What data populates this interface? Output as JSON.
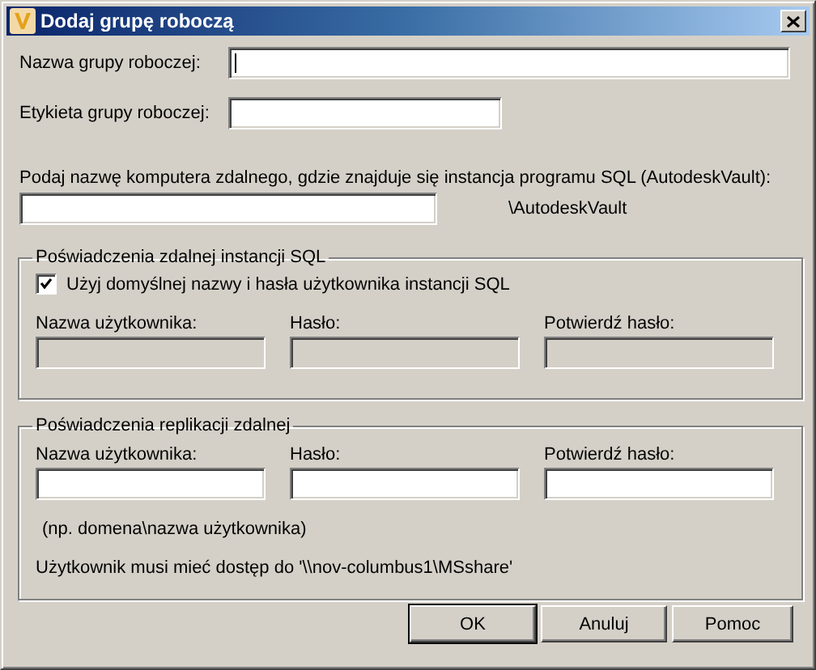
{
  "window": {
    "title": "Dodaj grupę roboczą"
  },
  "fields": [
    {
      "label": "Nazwa grupy roboczej:",
      "focused": true
    },
    {
      "label": "Etykieta grupy roboczej:",
      "focused": false
    }
  ],
  "server": {
    "label": "Podaj nazwę komputera zdalnego, gdzie znajduje się instancja programu SQL (AutodeskVault):",
    "suffix": "\\AutodeskVault"
  },
  "groups": [
    {
      "title": "Poświadczenia zdalnej instancji SQL",
      "checkbox": {
        "label": "Użyj domyślnej nazwy i hasła użytkownika instancji SQL",
        "checked": true
      },
      "fields": [
        {
          "label": "Nazwa użytkownika:",
          "disabled": true
        },
        {
          "label": "Hasło:",
          "disabled": true
        },
        {
          "label": "Potwierdź hasło:",
          "disabled": true
        }
      ]
    },
    {
      "title": "Poświadczenia replikacji zdalnej",
      "fields": [
        {
          "label": "Nazwa użytkownika:",
          "disabled": false
        },
        {
          "label": "Hasło:",
          "disabled": false
        },
        {
          "label": "Potwierdź hasło:",
          "disabled": false
        }
      ],
      "hint": "(np. domena\\nazwa użytkownika)",
      "note": "Użytkownik musi mieć dostęp do '\\\\nov-columbus1\\MSshare'"
    }
  ],
  "buttons": [
    {
      "label": "OK",
      "default": true
    },
    {
      "label": "Anuluj",
      "default": false
    },
    {
      "label": "Pomoc",
      "default": false
    }
  ]
}
